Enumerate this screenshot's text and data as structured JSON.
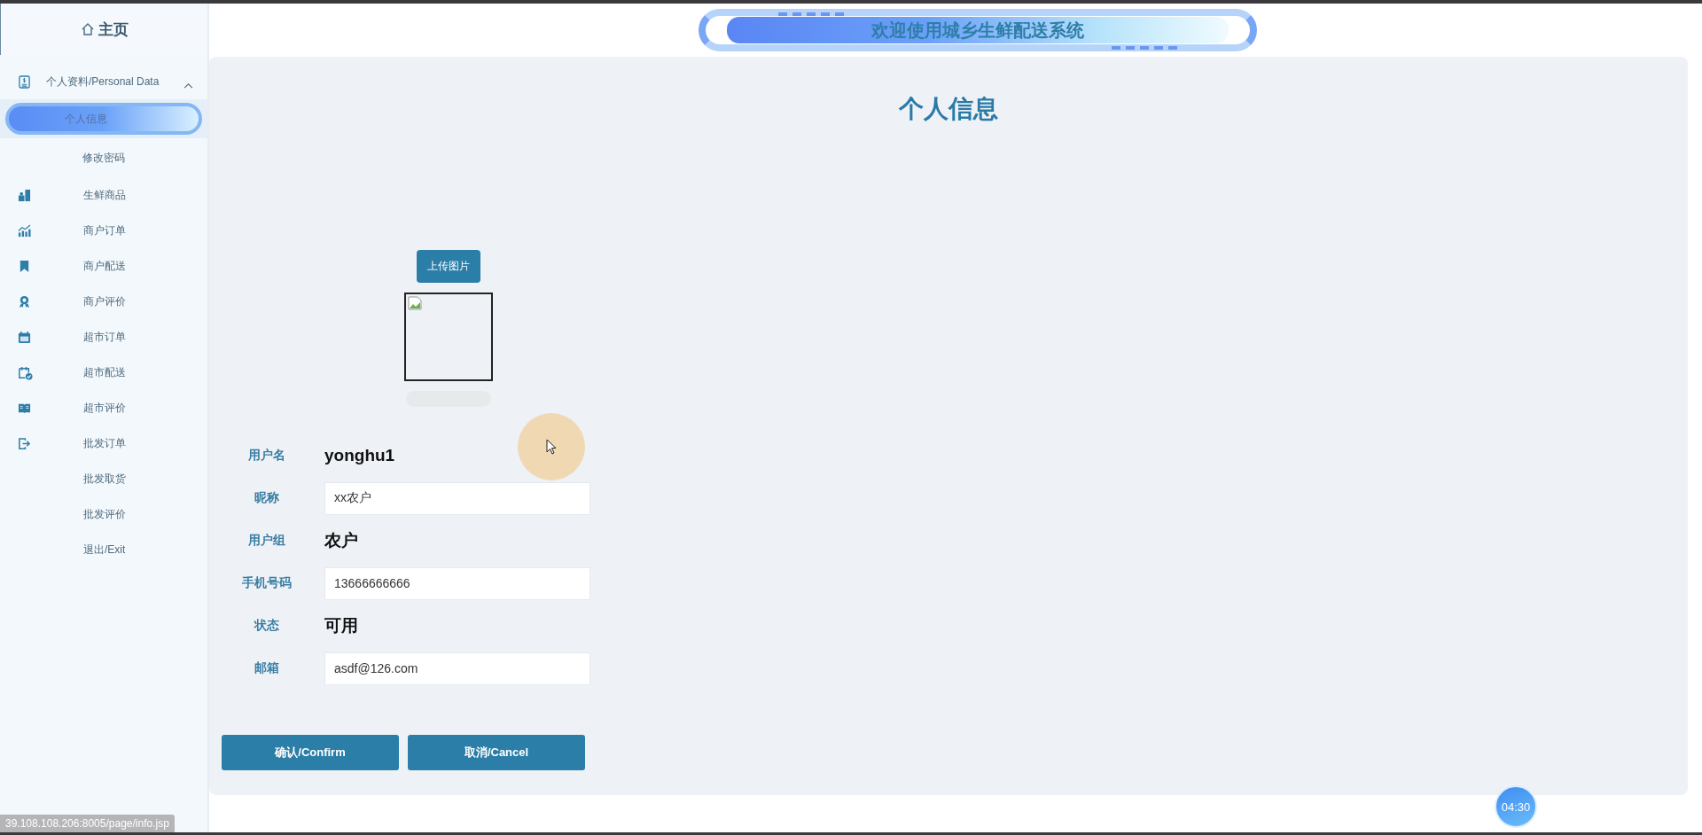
{
  "sidebar": {
    "home": "主页",
    "group": {
      "label": "个人资料/Personal Data",
      "expanded": true,
      "children": [
        {
          "label": "个人信息",
          "selected": true
        },
        {
          "label": "修改密码",
          "selected": false
        }
      ]
    },
    "items": [
      {
        "label": "生鲜商品"
      },
      {
        "label": "商户订单"
      },
      {
        "label": "商户配送"
      },
      {
        "label": "商户评价"
      },
      {
        "label": "超市订单"
      },
      {
        "label": "超市配送"
      },
      {
        "label": "超市评价"
      },
      {
        "label": "批发订单"
      },
      {
        "label": "批发取货"
      },
      {
        "label": "批发评价"
      },
      {
        "label": "退出/Exit"
      }
    ]
  },
  "header": {
    "title": "欢迎使用城乡生鲜配送系统"
  },
  "page": {
    "title": "个人信息",
    "upload_button": "上传图片",
    "fields": [
      {
        "label": "用户名",
        "kind": "text",
        "value": "yonghu1"
      },
      {
        "label": "昵称",
        "kind": "input",
        "value": "xx农户"
      },
      {
        "label": "用户组",
        "kind": "text",
        "value": "农户"
      },
      {
        "label": "手机号码",
        "kind": "input",
        "value": "13666666666"
      },
      {
        "label": "状态",
        "kind": "text",
        "value": "可用"
      },
      {
        "label": "邮箱",
        "kind": "input",
        "value": "asdf@126.com"
      }
    ],
    "buttons": [
      "确认/Confirm",
      "取消/Cancel"
    ]
  },
  "status_url": "39.108.108.206:8005/page/info.jsp",
  "timer": "04:30"
}
